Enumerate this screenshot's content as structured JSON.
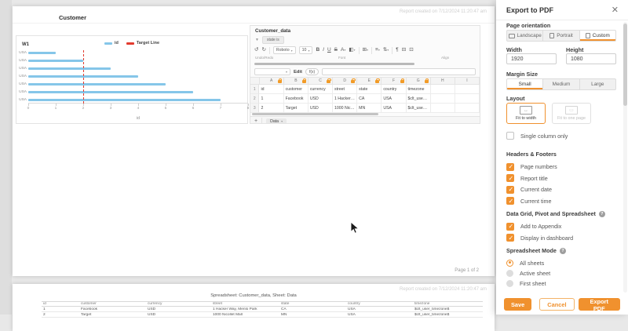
{
  "canvas": {
    "page1": {
      "created_text": "Report created on 7/12/2024 11:20:47 am",
      "title": "Customer",
      "page_label": "Page 1 of 2"
    },
    "page2": {
      "created_text": "Report created on 7/12/2024 11:20:47 am",
      "title": "Spreadsheet: Customer_data, Sheet: Data",
      "table": {
        "headers": [
          "id",
          "customer",
          "currency",
          "street",
          "state",
          "country",
          "timezone"
        ],
        "rows": [
          [
            "1",
            "Facebook",
            "USD",
            "1 Hacker Way, Menlo Park",
            "CA",
            "USA",
            "$clt_user_timezone$"
          ],
          [
            "2",
            "Target",
            "USD",
            "1000 Nicollet Mall",
            "MN",
            "USA",
            "$clt_user_timezone$"
          ]
        ]
      }
    }
  },
  "chart_widget": {
    "title": "W1"
  },
  "chart_data": {
    "type": "bar",
    "orientation": "horizontal",
    "title": "",
    "categories": [
      "USA",
      "USA",
      "USA",
      "USA",
      "USA",
      "USA",
      "USA"
    ],
    "values": [
      1,
      2,
      3,
      4,
      5,
      6,
      7
    ],
    "target_line": 2,
    "xlabel": "id",
    "ylabel": "",
    "xlim": [
      0,
      8
    ],
    "xticks": [
      0,
      1,
      2,
      3,
      4,
      5,
      6,
      7,
      8
    ],
    "grid": false,
    "legend_position": "top",
    "legend": [
      {
        "label": "id",
        "color": "#85c6e9"
      },
      {
        "label": "Target Line",
        "color": "#e23b2e"
      }
    ],
    "bar_color": "#85c6e9",
    "target_color": "#e23b2e"
  },
  "spreadsheet_widget": {
    "title": "Customer_data",
    "filter_chip": "state is",
    "toolbar": {
      "items": [
        {
          "kind": "btn",
          "glyph": "↺",
          "name": "undo-icon"
        },
        {
          "kind": "btn",
          "glyph": "↻",
          "name": "redo-icon"
        },
        {
          "kind": "div"
        },
        {
          "kind": "sel",
          "label": "Roboto",
          "name": "font-family-select"
        },
        {
          "kind": "sel",
          "label": "10",
          "name": "font-size-select"
        },
        {
          "kind": "btn",
          "glyph": "B",
          "name": "bold-button",
          "cls": "b"
        },
        {
          "kind": "btn",
          "glyph": "I",
          "name": "italic-button",
          "cls": "i"
        },
        {
          "kind": "btn",
          "glyph": "U",
          "name": "underline-button",
          "cls": "u"
        },
        {
          "kind": "btn",
          "glyph": "S",
          "name": "strikethrough-button",
          "cls": "s"
        },
        {
          "kind": "btn",
          "glyph": "A",
          "name": "font-color-button",
          "caret": true
        },
        {
          "kind": "btn",
          "glyph": "◧",
          "name": "fill-color-button",
          "caret": true
        },
        {
          "kind": "div"
        },
        {
          "kind": "btn",
          "glyph": "⊞",
          "name": "borders-button",
          "caret": true
        },
        {
          "kind": "div"
        },
        {
          "kind": "btn",
          "glyph": "≡",
          "name": "horizontal-align-button",
          "caret": true
        },
        {
          "kind": "btn",
          "glyph": "⇅",
          "name": "vertical-align-button",
          "caret": true
        },
        {
          "kind": "div"
        },
        {
          "kind": "btn",
          "glyph": "¶",
          "name": "wrap-text-button"
        },
        {
          "kind": "btn",
          "glyph": "⊟",
          "name": "merge-cells-button"
        },
        {
          "kind": "btn",
          "glyph": "⊡",
          "name": "format-button"
        }
      ],
      "group_labels": [
        "Undo/Redo",
        "Font",
        "Align"
      ]
    },
    "formula_bar": {
      "edit_label": "Edit",
      "fx_label": "f(x)"
    },
    "grid": {
      "columns": [
        {
          "letter": "A",
          "lock": true
        },
        {
          "letter": "B",
          "lock": true
        },
        {
          "letter": "C",
          "lock": true
        },
        {
          "letter": "D",
          "lock": true
        },
        {
          "letter": "E",
          "lock": true
        },
        {
          "letter": "F",
          "lock": true
        },
        {
          "letter": "G",
          "lock": true
        },
        {
          "letter": "H",
          "lock": false
        },
        {
          "letter": "I",
          "lock": false
        }
      ],
      "rows": [
        {
          "num": "1",
          "cells": [
            "id",
            "customer",
            "currency",
            "street",
            "state",
            "country",
            "timezone",
            "",
            ""
          ]
        },
        {
          "num": "2",
          "cells": [
            "1",
            "Facebook",
            "USD",
            "1 Hacker Way, Menlo Park",
            "CA",
            "USA",
            "$clt_user_timezone$",
            "",
            ""
          ]
        },
        {
          "num": "3",
          "cells": [
            "2",
            "Target",
            "USD",
            "1000 Nicollet Mall",
            "MN",
            "USA",
            "$clt_user_timezone$",
            "",
            ""
          ]
        }
      ]
    },
    "add_label": "+",
    "sheet_tab": "Data"
  },
  "export_panel": {
    "title": "Export to PDF",
    "accent": "#f0912e",
    "page_orientation": {
      "label": "Page orientation",
      "options": [
        "Landscape",
        "Portrait",
        "Custom"
      ],
      "selected": "Custom"
    },
    "width": {
      "label": "Width",
      "value": "1920"
    },
    "height": {
      "label": "Height",
      "value": "1080"
    },
    "margin": {
      "label": "Margin Size",
      "options": [
        "Small",
        "Medium",
        "Large"
      ],
      "selected": "Small"
    },
    "layout": {
      "label": "Layout",
      "options": [
        {
          "label": "Fit to width",
          "selected": true,
          "disabled": false
        },
        {
          "label": "Fit to one page",
          "selected": false,
          "disabled": true
        }
      ]
    },
    "single_column": {
      "label": "Single column only",
      "checked": false
    },
    "headers_footers": {
      "label": "Headers & Footers",
      "items": [
        {
          "label": "Page numbers",
          "checked": true
        },
        {
          "label": "Report title",
          "checked": true
        },
        {
          "label": "Current date",
          "checked": true
        },
        {
          "label": "Current time",
          "checked": true
        }
      ]
    },
    "data_grid": {
      "label": "Data Grid, Pivot and Spreadsheet",
      "items": [
        {
          "label": "Add to Appendix",
          "checked": true
        },
        {
          "label": "Display in dashboard",
          "checked": true
        }
      ]
    },
    "spreadsheet_mode": {
      "label": "Spreadsheet Mode",
      "options": [
        {
          "label": "All sheets",
          "selected": true
        },
        {
          "label": "Active sheet",
          "selected": false
        },
        {
          "label": "First sheet",
          "selected": false
        }
      ]
    },
    "buttons": {
      "save": "Save",
      "cancel": "Cancel",
      "export": "Export PDF"
    }
  }
}
